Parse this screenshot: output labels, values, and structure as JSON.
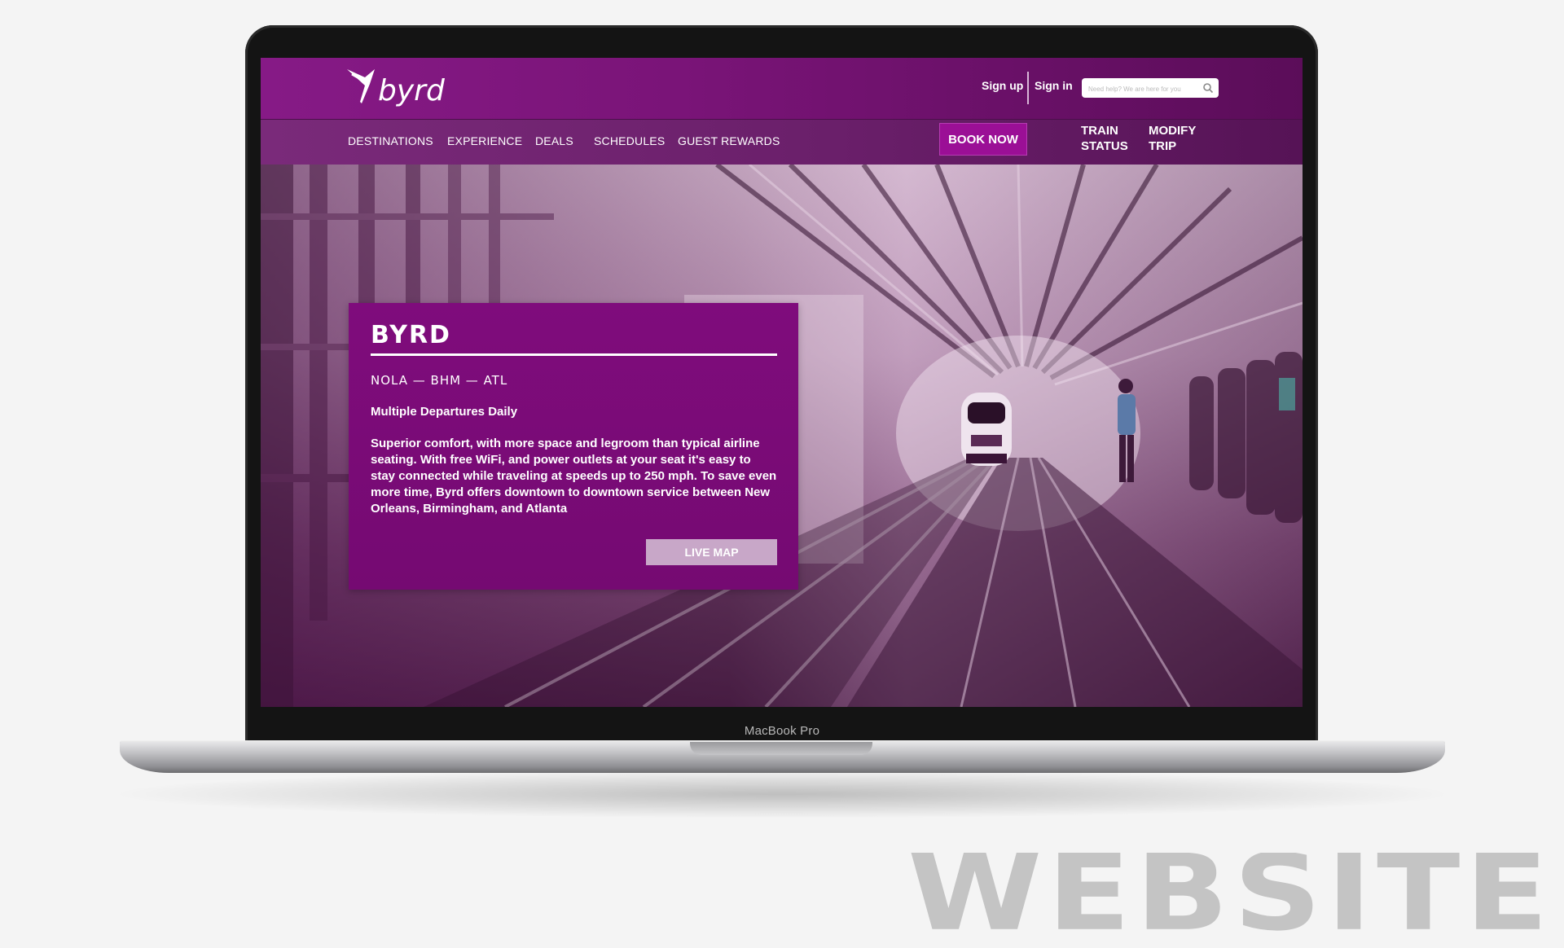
{
  "device": {
    "label": "MacBook Pro"
  },
  "watermark": "WEBSITE",
  "header": {
    "brand": "byrd",
    "sign_up": "Sign up",
    "sign_in": "Sign in",
    "search_placeholder": "Need help? We are here for you"
  },
  "nav": {
    "items": [
      "DESTINATIONS",
      "EXPERIENCE",
      "DEALS",
      "SCHEDULES",
      "GUEST REWARDS"
    ],
    "book_now": "BOOK NOW",
    "train_status": [
      "TRAIN",
      "STATUS"
    ],
    "modify_trip": [
      "MODIFY",
      "TRIP"
    ]
  },
  "card": {
    "title": "BYRD",
    "route": "NOLA — BHM — ATL",
    "subtitle": "Multiple Departures Daily",
    "body": "Superior comfort, with more space and legroom than typical airline seating. With free WiFi, and power outlets at your seat it's easy to stay connected while traveling at speeds up to 250 mph. To save even more time, Byrd offers downtown to downtown service between New Orleans, Birmingham, and Atlanta",
    "button": "LIVE MAP"
  },
  "colors": {
    "brand_purple": "#7f0c7c",
    "nav_purple": "#6a1f6a",
    "book_now_bg": "#9b0f96",
    "live_map_bg": "#c8a7c8"
  }
}
